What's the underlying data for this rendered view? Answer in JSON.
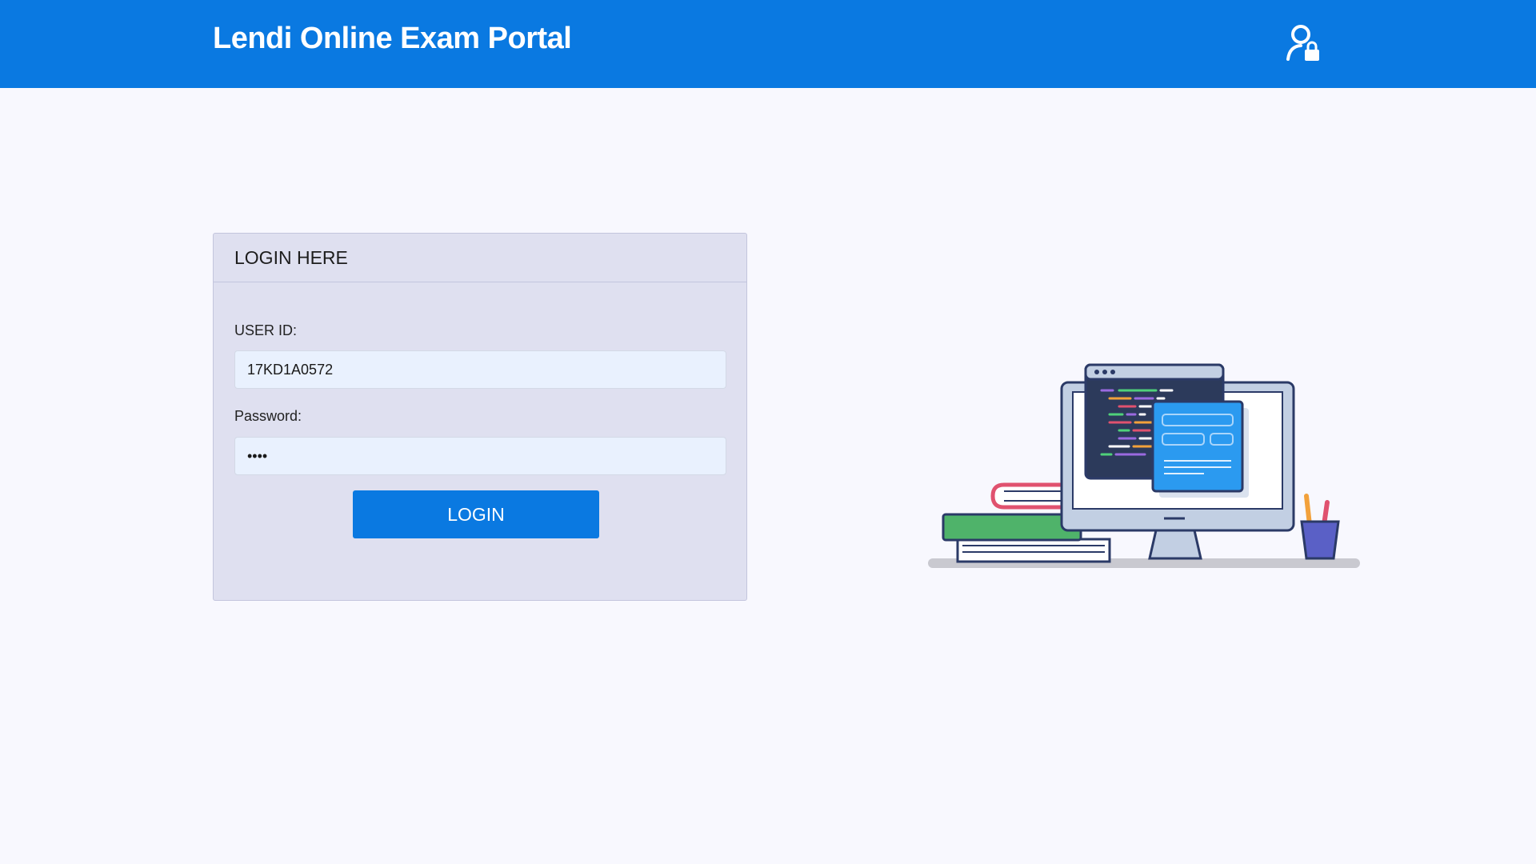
{
  "header": {
    "title": "Lendi Online Exam Portal",
    "user_icon": "user-lock-icon",
    "bg_color": "#0a79e1"
  },
  "login": {
    "title": "LOGIN HERE",
    "user_id_label": "USER ID:",
    "user_id_value": "17KD1A0572",
    "password_label": "Password:",
    "password_value": "1234",
    "button_label": "LOGIN"
  },
  "illustration": {
    "icon": "computer-desk-illustration"
  }
}
